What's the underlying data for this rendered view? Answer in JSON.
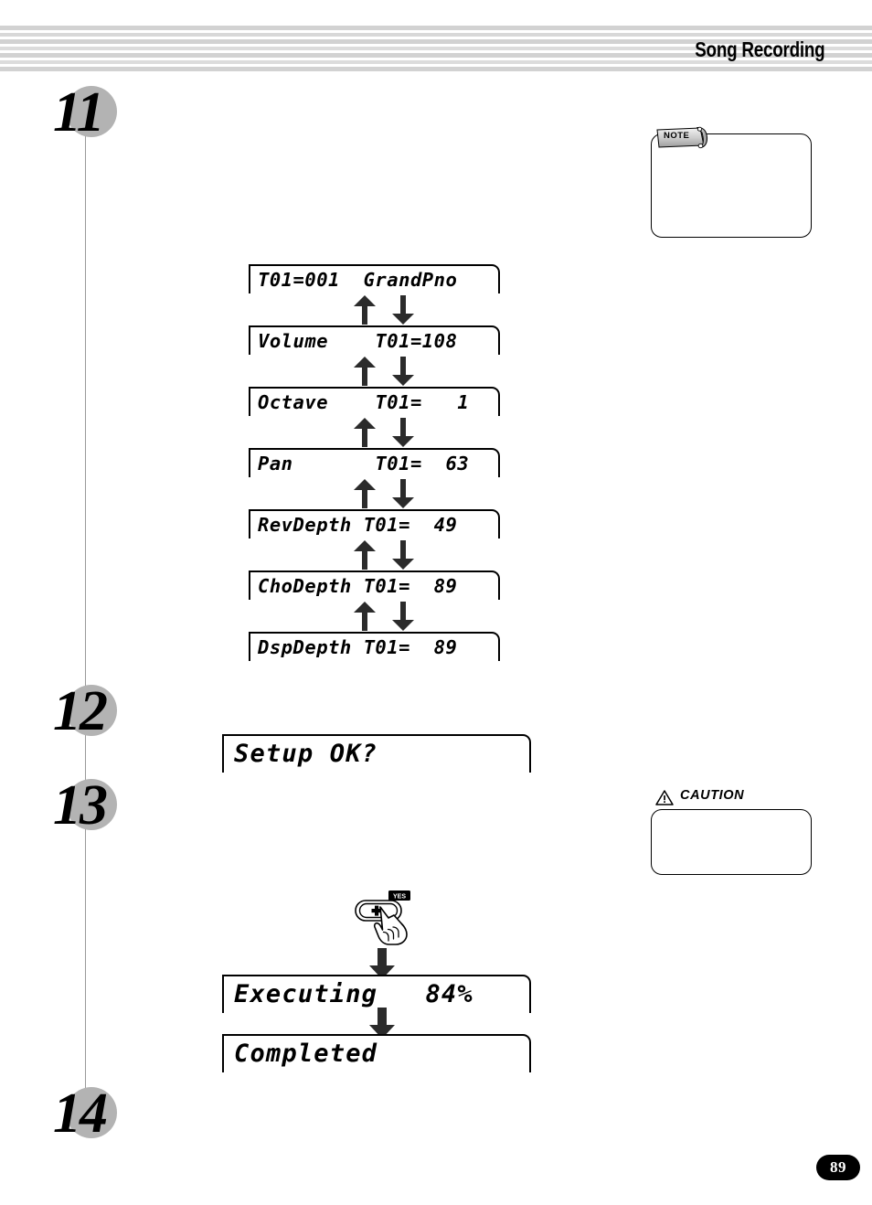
{
  "header": {
    "title": "Song Recording",
    "stripe_color_light": "#e9e9e9",
    "stripe_color_dark": "#d2d2d2"
  },
  "steps": [
    {
      "number": "11"
    },
    {
      "number": "12"
    },
    {
      "number": "13"
    },
    {
      "number": "14"
    }
  ],
  "lcd_chain": [
    {
      "text": "T01=001  GrandPno"
    },
    {
      "text": "Volume    T01=108"
    },
    {
      "text": "Octave    T01=   1"
    },
    {
      "text": "Pan       T01=  63"
    },
    {
      "text": "RevDepth T01=  49"
    },
    {
      "text": "ChoDepth T01=  89"
    },
    {
      "text": "DspDepth T01=  89"
    }
  ],
  "lcd_setup": {
    "text": "Setup OK?"
  },
  "lcd_executing": {
    "text": "Executing   84%"
  },
  "lcd_completed": {
    "text": "Completed"
  },
  "yes_button": {
    "label": "YES",
    "symbol": "+"
  },
  "note_callout": {
    "label": "NOTE"
  },
  "caution_callout": {
    "label": "CAUTION"
  },
  "page": {
    "number": "89"
  }
}
